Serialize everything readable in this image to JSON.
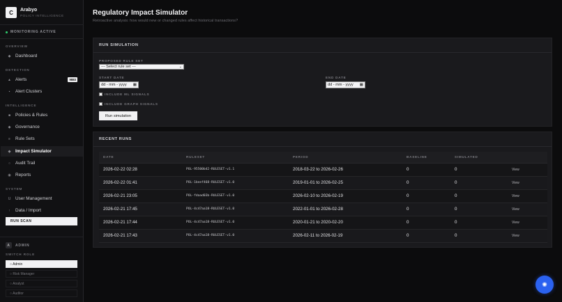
{
  "brand": {
    "logo_letter": "C",
    "name": "Arabyo",
    "subtitle": "POLICY INTELLIGENCE"
  },
  "status": "MONITORING ACTIVE",
  "sidebar": {
    "sections": [
      "OVERVIEW",
      "DETECTION",
      "INTELLIGENCE",
      "SYSTEM"
    ],
    "items": [
      {
        "label": "Dashboard",
        "icon": "diamond-icon"
      },
      {
        "label": "Alerts",
        "icon": "warning-icon",
        "badge": "9883"
      },
      {
        "label": "Alert Clusters",
        "icon": "cluster-icon"
      },
      {
        "label": "Policies & Rules",
        "icon": "document-icon"
      },
      {
        "label": "Governance",
        "icon": "diamond-icon"
      },
      {
        "label": "Rule Sets",
        "icon": "list-icon"
      },
      {
        "label": "Impact Simulator",
        "icon": "diamond-icon",
        "active": true
      },
      {
        "label": "Audit Trail",
        "icon": "clock-icon"
      },
      {
        "label": "Reports",
        "icon": "chart-icon"
      },
      {
        "label": "User Management",
        "icon": "user-icon"
      },
      {
        "label": "Data / Import",
        "icon": "import-icon"
      }
    ],
    "run_scan": "RUN SCAN",
    "user_initial": "A",
    "user_name": "ADMIN",
    "switch_role_label": "SWITCH ROLE",
    "roles": [
      "○ Admin",
      "○ Risk Manager",
      "○ Analyst",
      "○ Auditor"
    ]
  },
  "page": {
    "title": "Regulatory Impact Simulator",
    "subtitle": "Retroactive analysis: how would new or changed rules affect historical transactions?"
  },
  "simulation": {
    "heading": "RUN SIMULATION",
    "rule_set_label": "PROPOSED RULE SET",
    "rule_set_value": "--- Select rule set ---",
    "start_label": "START DATE",
    "start_value": "dd - mm - yyyy",
    "end_label": "END DATE",
    "end_value": "dd - mm - yyyy",
    "ml_label": "INCLUDE ML SIGNALS",
    "graph_label": "INCLUDE GRAPH SIGNALS",
    "run_button": "Run simulation"
  },
  "recent": {
    "heading": "RECENT RUNS",
    "columns": [
      "DATE",
      "RULESET",
      "PERIOD",
      "BASELINE",
      "SIMULATED",
      ""
    ],
    "view_label": "View",
    "rows": [
      {
        "date": "2026-02-22 02:28",
        "ruleset": "POL-95500b42-RULESET-v1.1",
        "period": "2018-03-22 to 2026-02-26",
        "baseline": "0",
        "simulated": "0"
      },
      {
        "date": "2026-02-22 01:41",
        "ruleset": "POL-1beef468-RULESET-v1.0",
        "period": "2019-01-01 to 2026-02-25",
        "baseline": "0",
        "simulated": "0"
      },
      {
        "date": "2026-02-21 23:05",
        "ruleset": "POL-fdaad03b-RULESET-v1.0",
        "period": "2026-02-10 to 2026-02-19",
        "baseline": "0",
        "simulated": "0"
      },
      {
        "date": "2026-02-21 17:45",
        "ruleset": "POL-4c47aa18-RULESET-v1.0",
        "period": "2022-01-01 to 2026-02-28",
        "baseline": "0",
        "simulated": "0"
      },
      {
        "date": "2026-02-21 17:44",
        "ruleset": "POL-4c47aa18-RULESET-v1.0",
        "period": "2020-01-21 to 2020-02-20",
        "baseline": "0",
        "simulated": "0"
      },
      {
        "date": "2026-02-21 17:43",
        "ruleset": "POL-4c47aa18-RULESET-v1.0",
        "period": "2026-02-11 to 2026-02-19",
        "baseline": "0",
        "simulated": "0"
      }
    ]
  },
  "colors": {
    "accent": "#2b62f0",
    "status": "#2fcf6f"
  }
}
